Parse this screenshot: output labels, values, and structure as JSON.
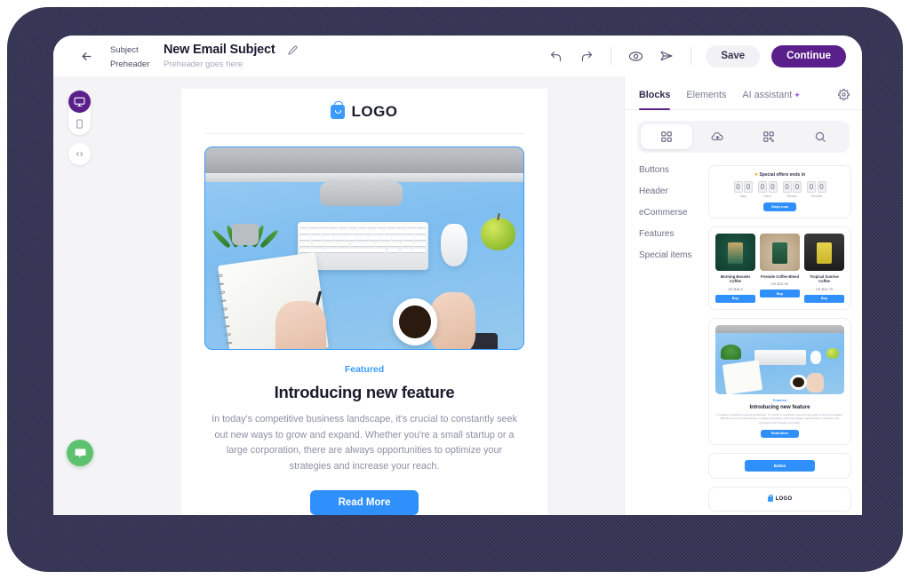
{
  "topbar": {
    "back_icon": "arrow-left-icon",
    "subject_label": "Subject",
    "subject_value": "New Email Subject",
    "edit_icon": "pencil-icon",
    "preheader_label": "Preheader",
    "preheader_value": "Preheader goes here",
    "undo_icon": "undo-icon",
    "redo_icon": "redo-icon",
    "preview_icon": "eye-icon",
    "send_icon": "paper-plane-icon",
    "save_label": "Save",
    "continue_label": "Continue",
    "gear_icon": "gear-icon"
  },
  "left_rail": {
    "desktop_icon": "desktop-monitor-icon",
    "mobile_icon": "mobile-phone-icon",
    "code_icon": "code-brackets-icon",
    "chat_icon": "chat-bubble-icon"
  },
  "email": {
    "logo_text": "LOGO",
    "logo_icon": "shopping-bag-icon",
    "hero_alt": "desk-flatlay-photo",
    "featured_tag": "Featured",
    "heading": "Introducing new feature",
    "paragraph": "In today's competitive business landscape, it's crucial to constantly seek out new ways to grow and expand. Whether you're a small startup or a large corporation, there are always opportunities to optimize your strategies and increase your reach.",
    "cta_label": "Read More"
  },
  "panel": {
    "tabs": [
      {
        "label": "Blocks",
        "active": true
      },
      {
        "label": "Elements",
        "active": false
      },
      {
        "label": "AI assistant",
        "active": false,
        "icon": "sparkle-icon"
      }
    ],
    "subtabs": [
      {
        "icon": "grid-blocks-icon",
        "active": true
      },
      {
        "icon": "cloud-upload-icon",
        "active": false
      },
      {
        "icon": "qr-blocks-icon",
        "active": false
      },
      {
        "icon": "search-icon",
        "active": false
      }
    ],
    "categories": [
      {
        "label": "Buttons"
      },
      {
        "label": "Header"
      },
      {
        "label": "eCommerse"
      },
      {
        "label": "Features"
      },
      {
        "label": "Special items"
      }
    ]
  },
  "blocks": {
    "countdown": {
      "title": "Special offers ends in",
      "star_icon": "star-icon",
      "groups": [
        {
          "digits": [
            "0",
            "0"
          ],
          "label": "Days"
        },
        {
          "digits": [
            "0",
            "0"
          ],
          "label": "Hours"
        },
        {
          "digits": [
            "0",
            "0"
          ],
          "label": "Minutes"
        },
        {
          "digits": [
            "0",
            "0"
          ],
          "label": "Seconds"
        }
      ],
      "cta_label": "Shop now"
    },
    "products": [
      {
        "name": "Morning Booster Coffee",
        "price": "US $18.9",
        "cta": "Buy"
      },
      {
        "name": "Fireside Coffee Blend",
        "price": "US $12.99",
        "cta": "Buy"
      },
      {
        "name": "Tropical Sunrise Coffee",
        "price": "US $14.75",
        "cta": "Buy"
      }
    ],
    "feature": {
      "tag": "Featured",
      "heading": "Introducing new feature",
      "paragraph": "In today's competitive business landscape, it's crucial to constantly seek out new ways to grow and expand. Whether you're a small startup or a large corporation, there are always opportunities to optimize your strategies and increase your reach.",
      "cta_label": "Read More"
    },
    "button_block": {
      "label": "Button"
    },
    "logo_block": {
      "label": "LOGO",
      "icon": "shopping-bag-icon"
    }
  },
  "colors": {
    "brand_purple": "#5b1f8c",
    "accent_blue": "#2f90fb",
    "frame_navy": "#22224c",
    "chat_green": "#5ec16e",
    "canvas_gray": "#f4f4f6"
  }
}
